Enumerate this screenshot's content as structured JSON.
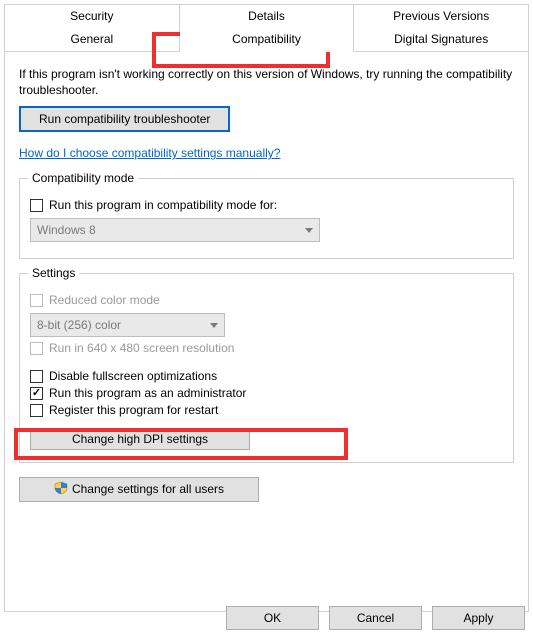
{
  "tabs": {
    "row1": [
      "Security",
      "Details",
      "Previous Versions"
    ],
    "row2": [
      "General",
      "Compatibility",
      "Digital Signatures"
    ],
    "active": "Compatibility"
  },
  "intro": "If this program isn't working correctly on this version of Windows, try running the compatibility troubleshooter.",
  "troubleshootBtn": "Run compatibility troubleshooter",
  "link": "How do I choose compatibility settings manually?",
  "compatGroup": {
    "title": "Compatibility mode",
    "checkbox": "Run this program in compatibility mode for:",
    "combo": "Windows 8"
  },
  "settingsGroup": {
    "title": "Settings",
    "reducedColor": "Reduced color mode",
    "colorCombo": "8-bit (256) color",
    "run640": "Run in 640 x 480 screen resolution",
    "disableFull": "Disable fullscreen optimizations",
    "runAdmin": "Run this program as an administrator",
    "register": "Register this program for restart",
    "dpiBtn": "Change high DPI settings"
  },
  "allUsersBtn": "Change settings for all users",
  "buttons": {
    "ok": "OK",
    "cancel": "Cancel",
    "apply": "Apply"
  }
}
